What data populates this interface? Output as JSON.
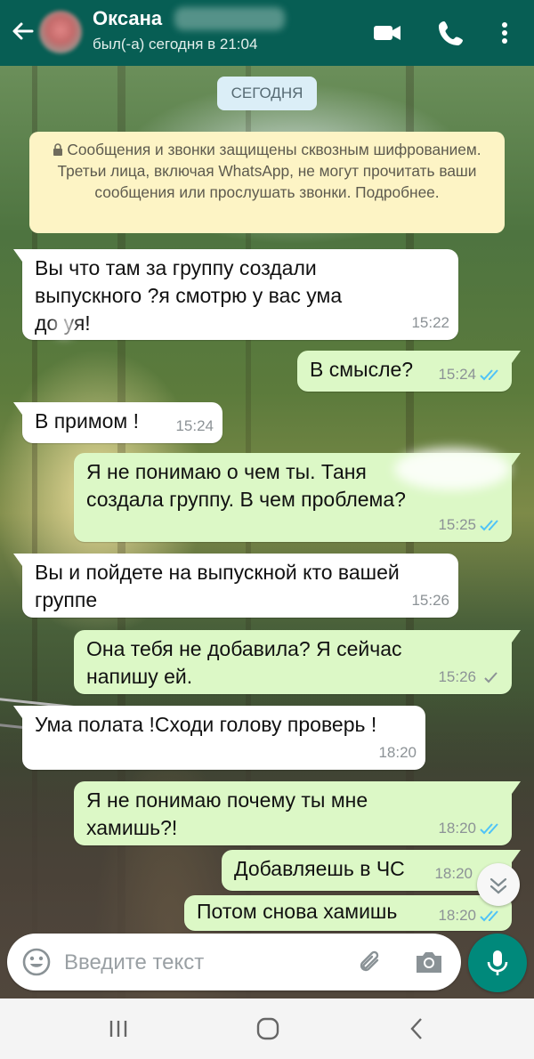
{
  "header": {
    "contact_name": "Оксана",
    "status": "был(-а) сегодня в 21:04"
  },
  "chat": {
    "date_chip": "СЕГОДНЯ",
    "encryption_notice": "Сообщения и звонки защищены сквозным шифрованием. Третьи лица, включая WhatsApp, не могут прочитать ваши сообщения или прослушать звонки. Подробнее.",
    "messages": [
      {
        "direction": "in",
        "text": "Вы что там за группу создали\nвыпускного ?я смотрю у вас ума\nдо уя!",
        "time": "15:22"
      },
      {
        "direction": "out",
        "text": "В смысле?",
        "time": "15:24",
        "status": "read"
      },
      {
        "direction": "in",
        "text": "В примом !",
        "time": "15:24"
      },
      {
        "direction": "out",
        "text": "Я не понимаю о чем ты. Таня\nсоздала группу. В чем проблема?",
        "time": "15:25",
        "status": "read"
      },
      {
        "direction": "in",
        "text": "Вы и пойдете на выпускной кто вашей\nгруппе",
        "time": "15:26"
      },
      {
        "direction": "out",
        "text": "Она тебя не добавила? Я сейчас\nнапишу ей.",
        "time": "15:26",
        "status": "delivered"
      },
      {
        "direction": "in",
        "text": "Ума полата !Сходи голову проверь !",
        "time": "18:20"
      },
      {
        "direction": "out",
        "text": "Я не понимаю почему ты мне\nхамишь?!",
        "time": "18:20",
        "status": "read"
      },
      {
        "direction": "out",
        "text": "Добавляешь в ЧС",
        "time": "18:20",
        "status": "read"
      },
      {
        "direction": "out",
        "text": "Потом снова хамишь",
        "time": "18:20",
        "status": "read"
      }
    ]
  },
  "composer": {
    "placeholder": "Введите текст"
  },
  "colors": {
    "header_bg": "#075e54",
    "outgoing_bubble": "#dcf8c6",
    "incoming_bubble": "#ffffff",
    "read_tick": "#4fc3f7",
    "mic_button": "#00897b"
  },
  "icons": [
    "back-arrow-icon",
    "video-call-icon",
    "phone-icon",
    "more-vert-icon",
    "lock-icon",
    "emoji-icon",
    "attach-icon",
    "camera-icon",
    "mic-icon",
    "scroll-down-icon",
    "recents-icon",
    "home-icon",
    "back-nav-icon"
  ]
}
